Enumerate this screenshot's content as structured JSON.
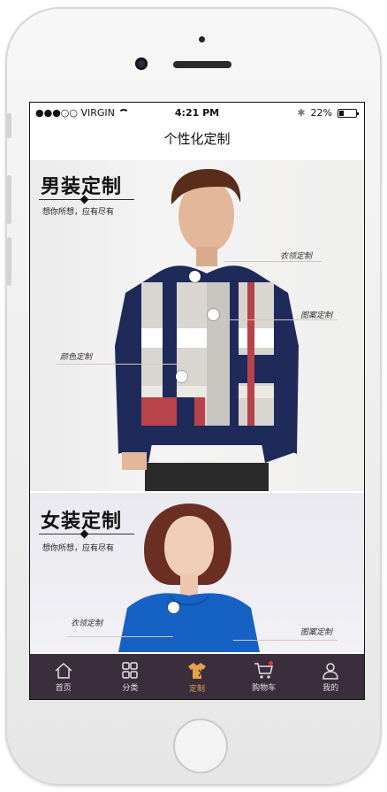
{
  "status_bar": {
    "carrier": "●●●○○ VIRGIN",
    "time": "4:21 PM",
    "battery": "22%"
  },
  "page_title": "个性化定制",
  "men_section": {
    "title": "男装定制",
    "subtitle": "想你所想，应有尽有",
    "tags": {
      "collar": "衣领定制",
      "pattern": "图案定制",
      "color": "颜色定制"
    }
  },
  "women_section": {
    "title": "女装定制",
    "subtitle": "想你所想，应有尽有",
    "tags": {
      "collar": "衣领定制",
      "pattern": "图案定制"
    }
  },
  "tabbar": {
    "items": [
      {
        "label": "首页",
        "icon": "home-icon"
      },
      {
        "label": "分类",
        "icon": "grid-icon"
      },
      {
        "label": "定制",
        "icon": "tailoring-icon"
      },
      {
        "label": "购物车",
        "icon": "cart-icon"
      },
      {
        "label": "我的",
        "icon": "user-icon"
      }
    ],
    "active_index": 2
  },
  "colors": {
    "tabbar_bg": "#3a2d3c",
    "tab_active": "#e4a04a",
    "tab_inactive": "#e6e0e6",
    "cart_badge": "#e03737",
    "sweater_navy": "#1e2a5a",
    "sweater_red": "#b8434b",
    "women_top_blue": "#1662c4"
  }
}
